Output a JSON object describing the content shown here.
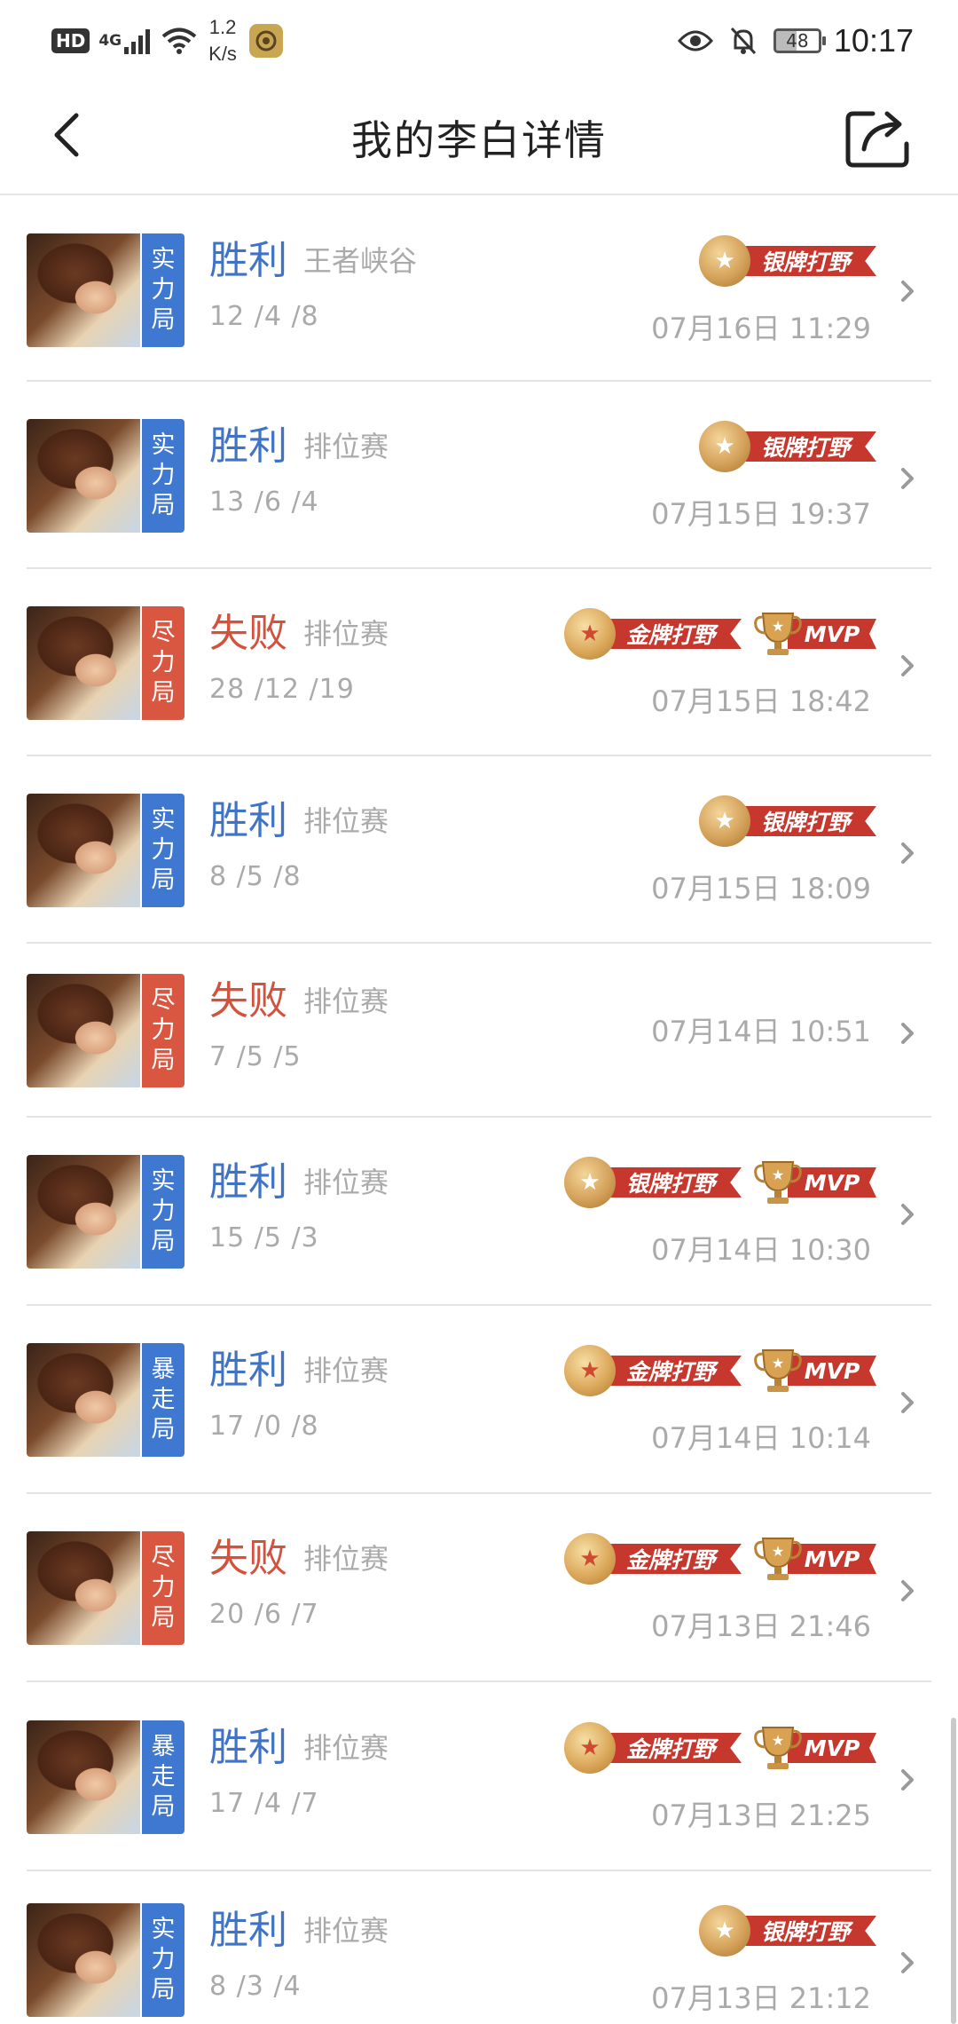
{
  "status_bar": {
    "hd": "HD",
    "network": "4G",
    "speed_value": "1.2",
    "speed_unit": "K/s",
    "battery": "48",
    "time": "10:17"
  },
  "header": {
    "title": "我的李白详情",
    "back_icon": "chevron-left-icon",
    "share_icon": "share-icon"
  },
  "matches": [
    {
      "tag": [
        "实",
        "力",
        "局"
      ],
      "tag_color": "#3f78d1",
      "result": "胜利",
      "result_type": "win",
      "mode": "王者峡谷",
      "kda": "12 /4 /8",
      "time": "07月16日 11:29",
      "badges": [
        "银牌打野"
      ]
    },
    {
      "tag": [
        "实",
        "力",
        "局"
      ],
      "tag_color": "#3f78d1",
      "result": "胜利",
      "result_type": "win",
      "mode": "排位赛",
      "kda": "13 /6 /4",
      "time": "07月15日 19:37",
      "badges": [
        "银牌打野"
      ]
    },
    {
      "tag": [
        "尽",
        "力",
        "局"
      ],
      "tag_color": "#d95740",
      "result": "失败",
      "result_type": "lose",
      "mode": "排位赛",
      "kda": "28 /12 /19",
      "time": "07月15日 18:42",
      "badges": [
        "金牌打野",
        "MVP"
      ]
    },
    {
      "tag": [
        "实",
        "力",
        "局"
      ],
      "tag_color": "#3f78d1",
      "result": "胜利",
      "result_type": "win",
      "mode": "排位赛",
      "kda": "8 /5 /8",
      "time": "07月15日 18:09",
      "badges": [
        "银牌打野"
      ]
    },
    {
      "tag": [
        "尽",
        "力",
        "局"
      ],
      "tag_color": "#d95740",
      "result": "失败",
      "result_type": "lose",
      "mode": "排位赛",
      "kda": "7 /5 /5",
      "time": "07月14日 10:51",
      "badges": []
    },
    {
      "tag": [
        "实",
        "力",
        "局"
      ],
      "tag_color": "#3f78d1",
      "result": "胜利",
      "result_type": "win",
      "mode": "排位赛",
      "kda": "15 /5 /3",
      "time": "07月14日 10:30",
      "badges": [
        "银牌打野",
        "MVP"
      ]
    },
    {
      "tag": [
        "暴",
        "走",
        "局"
      ],
      "tag_color": "#3f78d1",
      "result": "胜利",
      "result_type": "win",
      "mode": "排位赛",
      "kda": "17 /0 /8",
      "time": "07月14日 10:14",
      "badges": [
        "金牌打野",
        "MVP"
      ]
    },
    {
      "tag": [
        "尽",
        "力",
        "局"
      ],
      "tag_color": "#d95740",
      "result": "失败",
      "result_type": "lose",
      "mode": "排位赛",
      "kda": "20 /6 /7",
      "time": "07月13日 21:46",
      "badges": [
        "金牌打野",
        "MVP"
      ]
    },
    {
      "tag": [
        "暴",
        "走",
        "局"
      ],
      "tag_color": "#3f78d1",
      "result": "胜利",
      "result_type": "win",
      "mode": "排位赛",
      "kda": "17 /4 /7",
      "time": "07月13日 21:25",
      "badges": [
        "金牌打野",
        "MVP"
      ]
    },
    {
      "tag": [
        "实",
        "力",
        "局"
      ],
      "tag_color": "#3f78d1",
      "result": "胜利",
      "result_type": "win",
      "mode": "排位赛",
      "kda": "8 /3 /4",
      "time": "07月13日 21:12",
      "badges": [
        "银牌打野"
      ]
    }
  ]
}
